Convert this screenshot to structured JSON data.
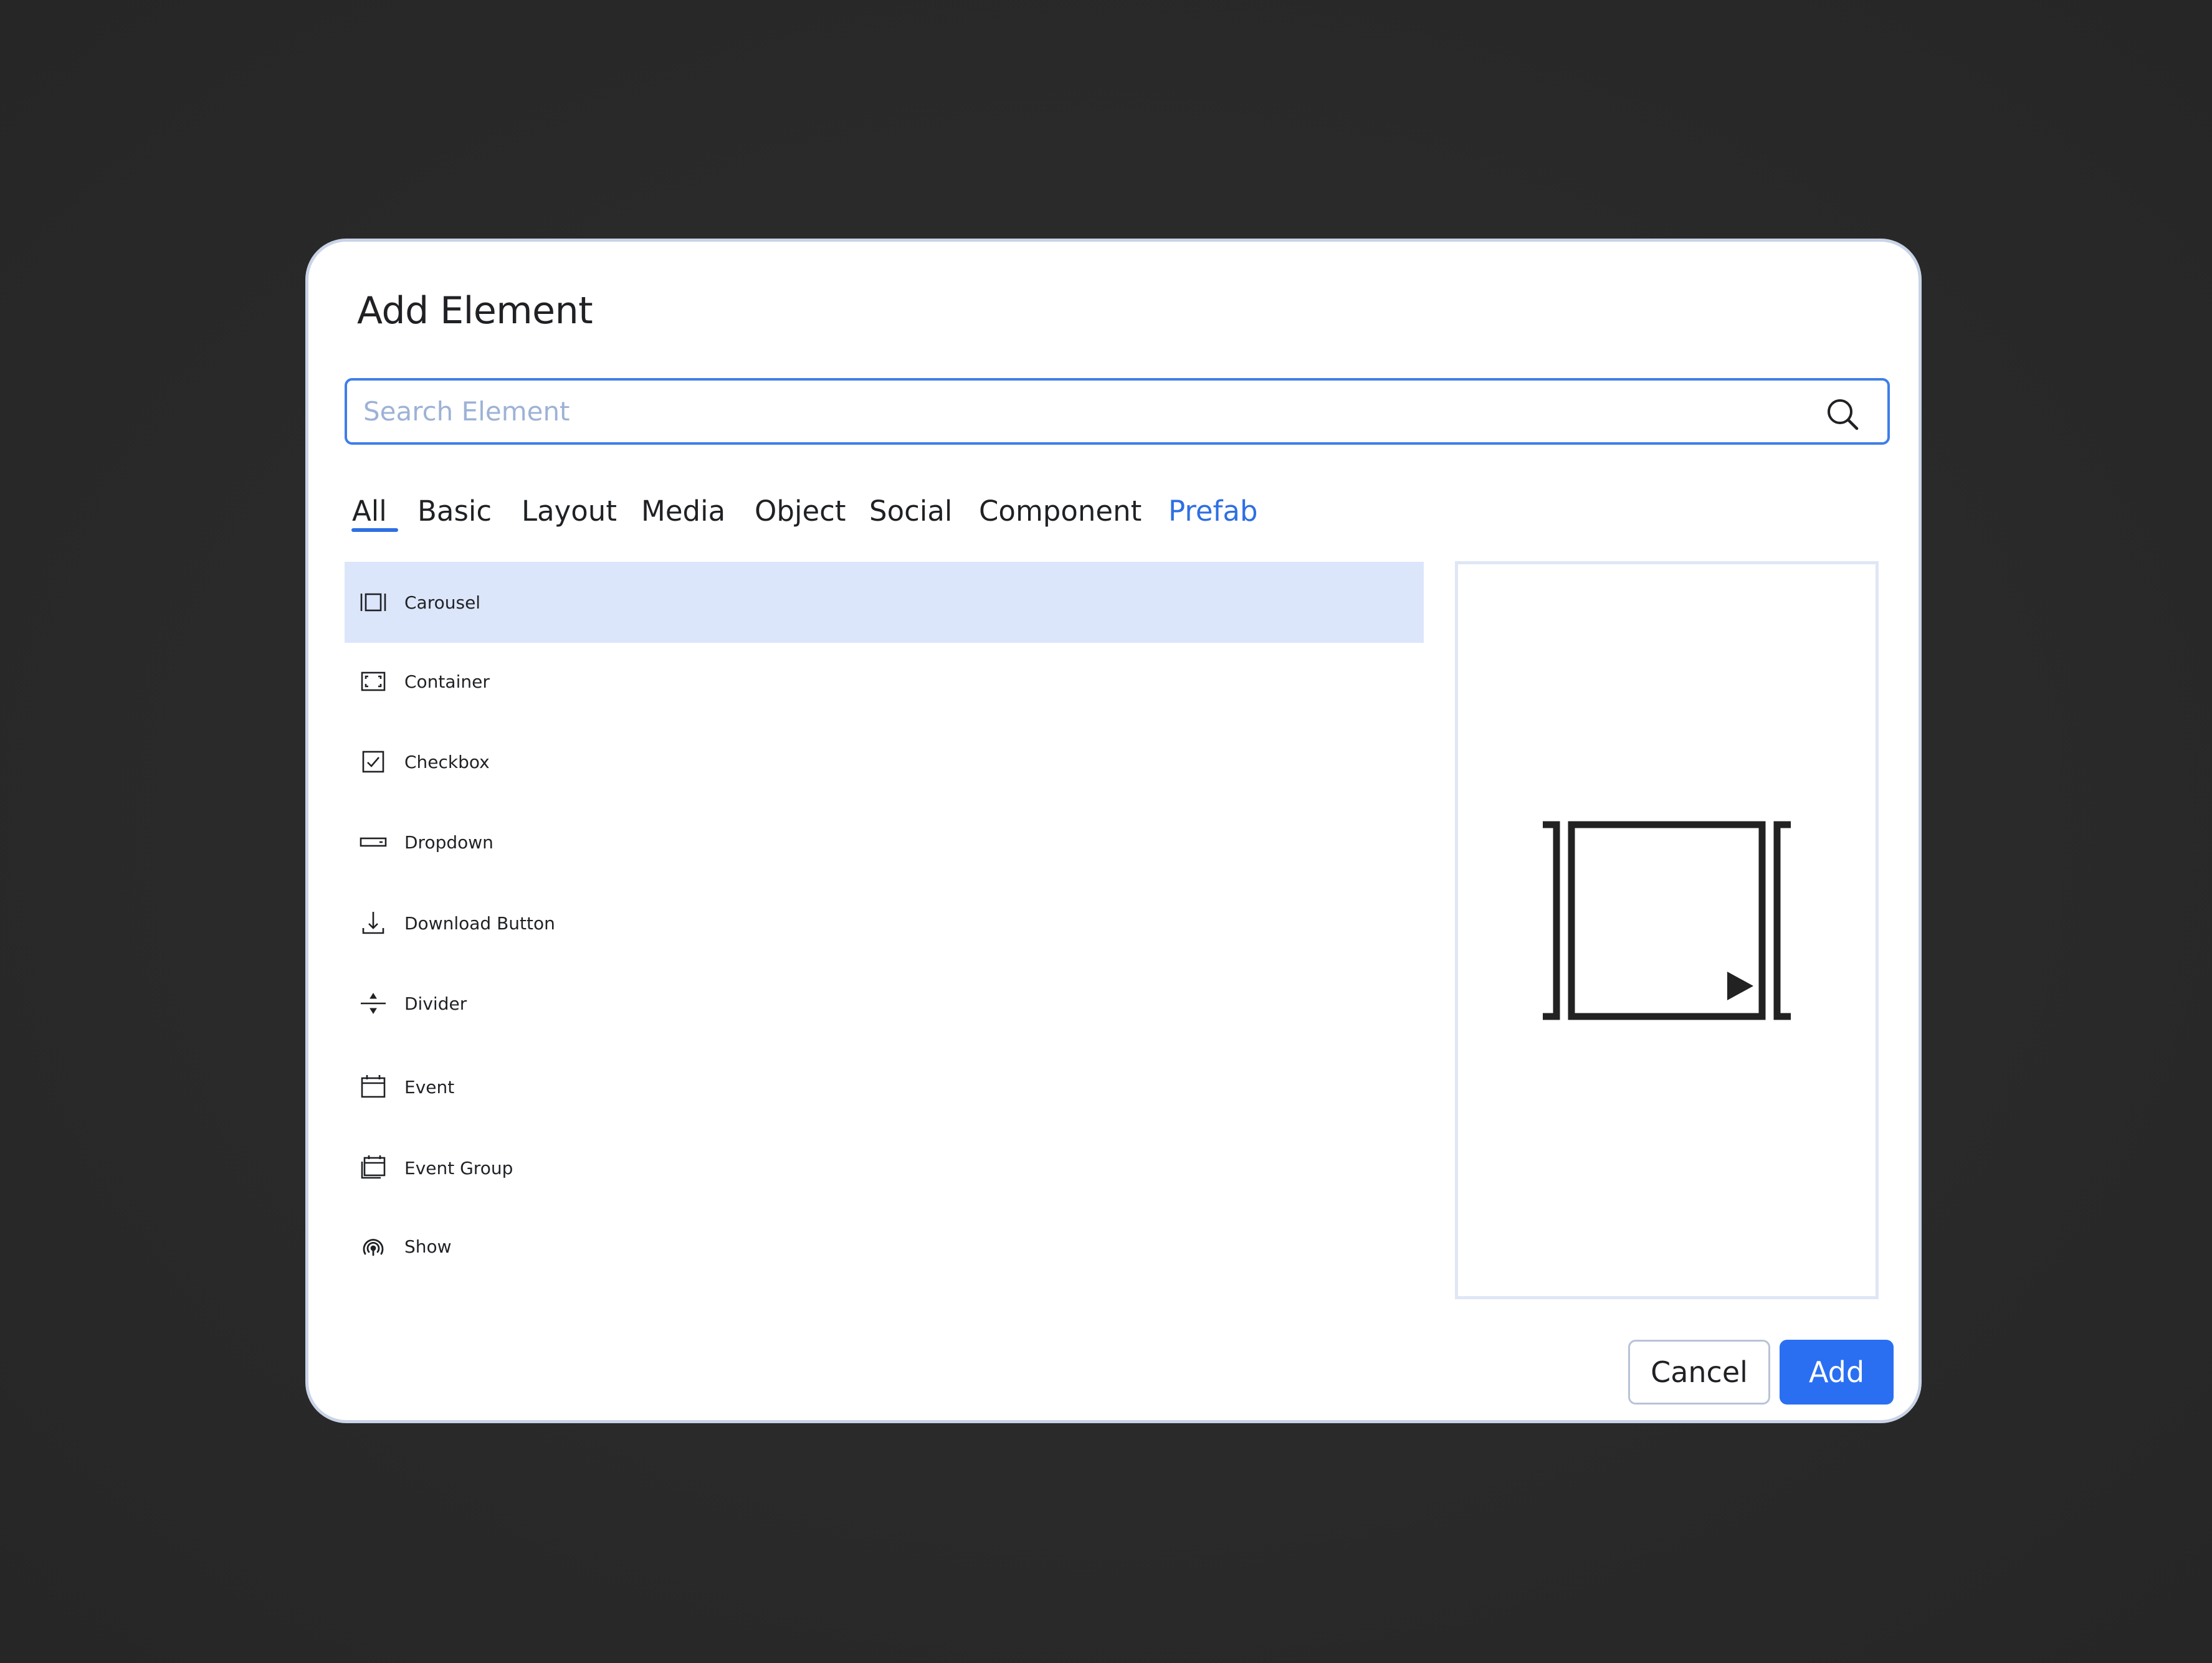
{
  "dialog": {
    "title": "Add Element"
  },
  "search": {
    "placeholder": "Search Element",
    "value": "",
    "icon": "search-icon"
  },
  "tabs": [
    {
      "label": "All",
      "active": true
    },
    {
      "label": "Basic"
    },
    {
      "label": "Layout"
    },
    {
      "label": "Media"
    },
    {
      "label": "Object"
    },
    {
      "label": "Social"
    },
    {
      "label": "Component"
    },
    {
      "label": "Prefab"
    }
  ],
  "elements": [
    {
      "label": "Carousel",
      "icon": "carousel-icon",
      "selected": true
    },
    {
      "label": "Container",
      "icon": "container-icon"
    },
    {
      "label": "Checkbox",
      "icon": "checkbox-icon"
    },
    {
      "label": "Dropdown",
      "icon": "dropdown-icon"
    },
    {
      "label": "Download Button",
      "icon": "download-icon"
    },
    {
      "label": "Divider",
      "icon": "divider-icon"
    },
    {
      "label": "Event",
      "icon": "calendar-icon"
    },
    {
      "label": "Event Group",
      "icon": "calendar-group-icon"
    },
    {
      "label": "Show",
      "icon": "broadcast-icon"
    }
  ],
  "preview": {
    "icon": "carousel-icon"
  },
  "actions": {
    "cancel_label": "Cancel",
    "add_label": "Add"
  },
  "colors": {
    "accent": "#2a6ff2",
    "selected_row": "#dbe6fb",
    "dialog_border": "#c9d3e6"
  }
}
